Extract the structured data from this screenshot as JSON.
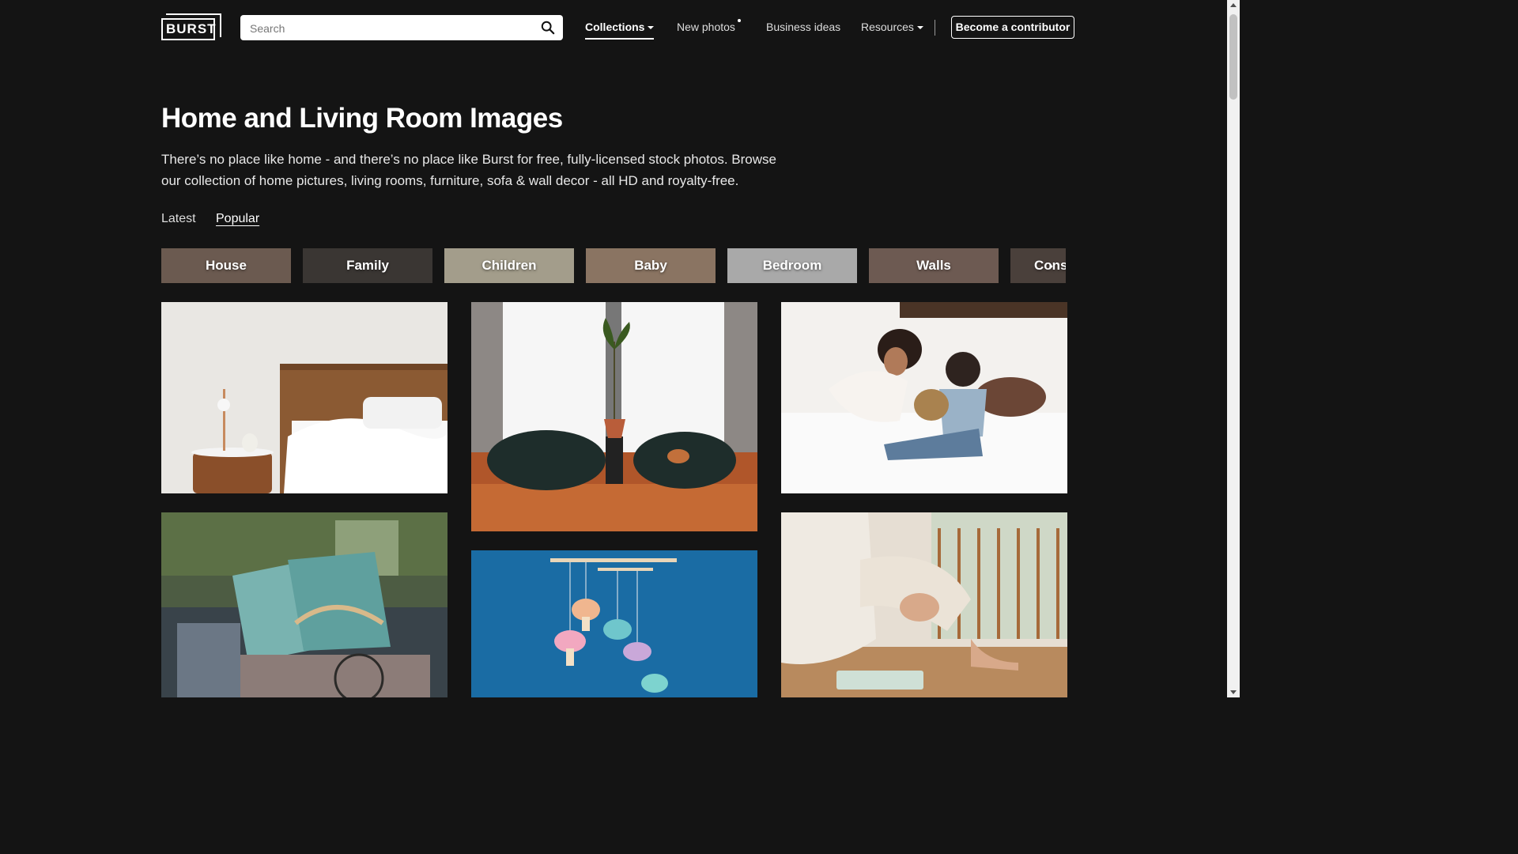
{
  "header": {
    "logo": "BURST",
    "search_placeholder": "Search",
    "nav": {
      "collections": "Collections",
      "new_photos": "New photos",
      "business_ideas": "Business ideas",
      "resources": "Resources"
    },
    "cta": "Become a contributor"
  },
  "page": {
    "title": "Home and Living Room Images",
    "description": "There’s no place like home - and there’s no place like Burst for free, fully-licensed stock photos. Browse our collection of home pictures, living rooms, furniture, sofa & wall decor - all HD and royalty-free."
  },
  "tabs": {
    "latest": "Latest",
    "popular": "Popular",
    "active": "Popular"
  },
  "categories": [
    {
      "label": "House",
      "color": "#6b5a50"
    },
    {
      "label": "Family",
      "color": "#3a3633"
    },
    {
      "label": "Children",
      "color": "#a39d8b"
    },
    {
      "label": "Baby",
      "color": "#8a7462"
    },
    {
      "label": "Bedroom",
      "color": "#a9a9a9"
    },
    {
      "label": "Walls",
      "color": "#6d5a52"
    },
    {
      "label": "Cons",
      "color": "#4a403b"
    }
  ],
  "photos": [
    {
      "subject": "bed-nightstand",
      "color": "#e6e3df"
    },
    {
      "subject": "window-beanbags",
      "color": "#c9c5bd"
    },
    {
      "subject": "mother-child-bed",
      "color": "#f0eeeb"
    },
    {
      "subject": "sofa-pillows",
      "color": "#4f5c44"
    },
    {
      "subject": "felt-mobile",
      "color": "#1d6ea2"
    },
    {
      "subject": "woman-floor",
      "color": "#d9d1c7"
    }
  ],
  "colors": {
    "background": "#141414",
    "text": "#ffffff"
  },
  "icons": {
    "search": "search-icon",
    "dropdown": "caret-down-icon",
    "carousel_next": "chevron-right-icon"
  }
}
